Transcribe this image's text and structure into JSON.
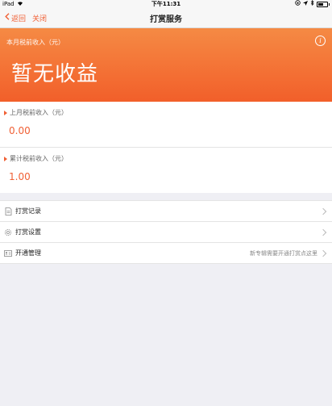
{
  "status_bar": {
    "device": "iPad",
    "time": "下午11:31"
  },
  "nav": {
    "back_label": "返回",
    "close_label": "关闭",
    "title": "打赏服务"
  },
  "hero": {
    "label": "本月税前收入（元）",
    "value": "暂无收益"
  },
  "stats": [
    {
      "label": "上月税前收入（元）",
      "value": "0.00"
    },
    {
      "label": "累计税前收入（元）",
      "value": "1.00"
    }
  ],
  "menu": [
    {
      "label": "打赏记录",
      "icon": "document-icon",
      "note": ""
    },
    {
      "label": "打赏设置",
      "icon": "gear-icon",
      "note": ""
    },
    {
      "label": "开通管理",
      "icon": "id-card-icon",
      "note": "新专辑需要开通打赏点这里"
    }
  ],
  "colors": {
    "accent": "#f06035",
    "hero_top": "#f58a44",
    "hero_bottom": "#f25f2a",
    "background": "#efeff4"
  }
}
